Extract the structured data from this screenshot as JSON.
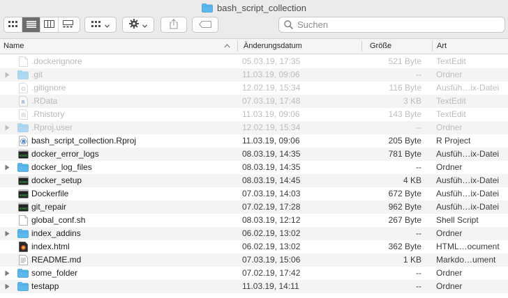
{
  "window": {
    "title": "bash_script_collection"
  },
  "toolbar": {
    "view_buttons": [
      "icon-view",
      "list-view",
      "column-view",
      "gallery-view"
    ],
    "active_view": "list-view",
    "group_button": "group-icon",
    "action_button": "gear-icon",
    "share_button": "share-icon",
    "tag_button": "tag-icon",
    "search_placeholder": "Suchen"
  },
  "columns": {
    "name": "Name",
    "date": "Änderungsdatum",
    "size": "Größe",
    "kind": "Art"
  },
  "files": [
    {
      "name": ".dockerignore",
      "date": "05.03.19, 17:35",
      "size": "521 Byte",
      "kind": "TextEdit",
      "icon": "document-icon",
      "hidden": true,
      "folder": false
    },
    {
      "name": ".git",
      "date": "11.03.19, 09:06",
      "size": "--",
      "kind": "Ordner",
      "icon": "folder-icon",
      "hidden": true,
      "folder": true
    },
    {
      "name": ".gitignore",
      "date": "12.02.19, 15:34",
      "size": "116 Byte",
      "kind": "Ausfüh…ix-Datei",
      "icon": "exec-document-icon",
      "hidden": true,
      "folder": false
    },
    {
      "name": ".RData",
      "date": "07.03.19, 17:48",
      "size": "3 KB",
      "kind": "TextEdit",
      "icon": "r-data-icon",
      "hidden": true,
      "folder": false
    },
    {
      "name": ".Rhistory",
      "date": "11.03.19, 09:06",
      "size": "143 Byte",
      "kind": "TextEdit",
      "icon": "r-history-icon",
      "hidden": true,
      "folder": false
    },
    {
      "name": ".Rproj.user",
      "date": "12.02.19, 15:34",
      "size": "--",
      "kind": "Ordner",
      "icon": "folder-icon",
      "hidden": true,
      "folder": true
    },
    {
      "name": "bash_script_collection.Rproj",
      "date": "11.03.19, 09:06",
      "size": "205 Byte",
      "kind": "R Project",
      "icon": "r-project-icon",
      "hidden": false,
      "folder": false
    },
    {
      "name": "docker_error_logs",
      "date": "08.03.19, 14:35",
      "size": "781 Byte",
      "kind": "Ausfüh…ix-Datei",
      "icon": "terminal-icon",
      "hidden": false,
      "folder": false
    },
    {
      "name": "docker_log_files",
      "date": "08.03.19, 14:35",
      "size": "--",
      "kind": "Ordner",
      "icon": "folder-icon",
      "hidden": false,
      "folder": true
    },
    {
      "name": "docker_setup",
      "date": "08.03.19, 14:45",
      "size": "4 KB",
      "kind": "Ausfüh…ix-Datei",
      "icon": "terminal-icon",
      "hidden": false,
      "folder": false
    },
    {
      "name": "Dockerfile",
      "date": "07.03.19, 14:03",
      "size": "672 Byte",
      "kind": "Ausfüh…ix-Datei",
      "icon": "terminal-icon",
      "hidden": false,
      "folder": false
    },
    {
      "name": "git_repair",
      "date": "07.02.19, 17:28",
      "size": "962 Byte",
      "kind": "Ausfüh…ix-Datei",
      "icon": "terminal-icon",
      "hidden": false,
      "folder": false
    },
    {
      "name": "global_conf.sh",
      "date": "08.03.19, 12:12",
      "size": "267 Byte",
      "kind": "Shell Script",
      "icon": "document-icon",
      "hidden": false,
      "folder": false
    },
    {
      "name": "index_addins",
      "date": "06.02.19, 13:02",
      "size": "--",
      "kind": "Ordner",
      "icon": "folder-icon",
      "hidden": false,
      "folder": true
    },
    {
      "name": "index.html",
      "date": "06.02.19, 13:02",
      "size": "362 Byte",
      "kind": "HTML…ocument",
      "icon": "html-icon",
      "hidden": false,
      "folder": false
    },
    {
      "name": "README.md",
      "date": "07.03.19, 15:06",
      "size": "1 KB",
      "kind": "Markdo…ument",
      "icon": "text-document-icon",
      "hidden": false,
      "folder": false
    },
    {
      "name": "some_folder",
      "date": "07.02.19, 17:42",
      "size": "--",
      "kind": "Ordner",
      "icon": "folder-icon",
      "hidden": false,
      "folder": true
    },
    {
      "name": "testapp",
      "date": "11.03.19, 14:11",
      "size": "--",
      "kind": "Ordner",
      "icon": "folder-icon",
      "hidden": false,
      "folder": true
    }
  ],
  "colors": {
    "folder": "#4fb3ec",
    "hidden_text": "#b9b9b9",
    "row_stripe": "#f4f4f4",
    "active_segment": "#6d6d6d"
  }
}
